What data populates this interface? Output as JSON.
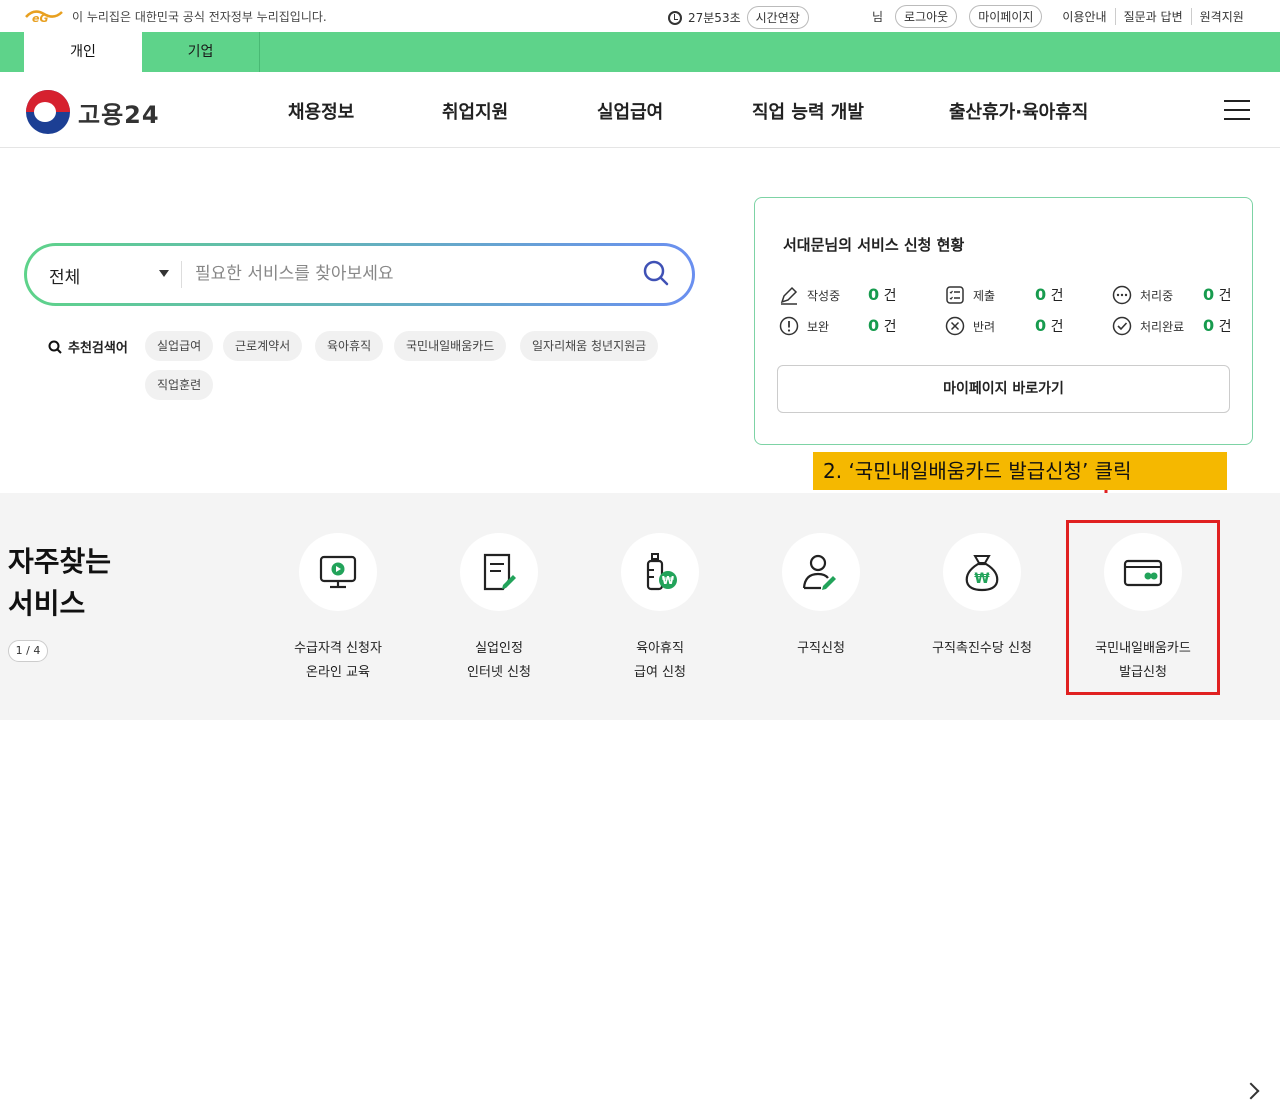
{
  "topbar": {
    "gov_notice": "이 누리집은 대한민국 공식 전자정부 누리집입니다.",
    "timer": "27분53초",
    "extend_label": "시간연장",
    "user_suffix": "님",
    "logout_label": "로그아웃",
    "mypage_label": "마이페이지",
    "links": [
      "이용안내",
      "질문과 답변",
      "원격지원"
    ]
  },
  "tabs": [
    "개인",
    "기업"
  ],
  "nav": {
    "brand": "고용24",
    "menu": [
      "채용정보",
      "취업지원",
      "실업급여",
      "직업 능력 개발",
      "출산휴가·육아휴직"
    ]
  },
  "search": {
    "scope": "전체",
    "placeholder": "필요한 서비스를 찾아보세요",
    "keywords_label": "추천검색어",
    "keywords": [
      "실업급여",
      "근로계약서",
      "육아휴직",
      "국민내일배움카드",
      "일자리채움 청년지원금",
      "직업훈련"
    ]
  },
  "status": {
    "title": "서대문님의 서비스 신청 현황",
    "items": [
      {
        "label": "작성중",
        "count": "0",
        "unit": "건"
      },
      {
        "label": "제출",
        "count": "0",
        "unit": "건"
      },
      {
        "label": "처리중",
        "count": "0",
        "unit": "건"
      },
      {
        "label": "보완",
        "count": "0",
        "unit": "건"
      },
      {
        "label": "반려",
        "count": "0",
        "unit": "건"
      },
      {
        "label": "처리완료",
        "count": "0",
        "unit": "건"
      }
    ],
    "mypage_button": "마이페이지 바로가기"
  },
  "callout": "2. ‘국민내일배움카드 발급신청’ 클릭",
  "frequent": {
    "title_line1": "자주찾는",
    "title_line2": "서비스",
    "pager": "1 / 4",
    "services": [
      {
        "label": "수급자격 신청자\n온라인 교육",
        "icon": "monitor-play-icon"
      },
      {
        "label": "실업인정\n인터넷 신청",
        "icon": "document-edit-icon"
      },
      {
        "label": "육아휴직\n급여 신청",
        "icon": "baby-bottle-won-icon"
      },
      {
        "label": "구직신청",
        "icon": "person-edit-icon"
      },
      {
        "label": "구직촉진수당 신청",
        "icon": "money-bag-icon"
      },
      {
        "label": "국민내일배움카드\n발급신청",
        "icon": "card-icon"
      }
    ]
  },
  "colors": {
    "brand_green": "#5ed38a",
    "accent_green": "#179b4e",
    "callout_yellow": "#f5b800",
    "highlight_red": "#e02020"
  }
}
